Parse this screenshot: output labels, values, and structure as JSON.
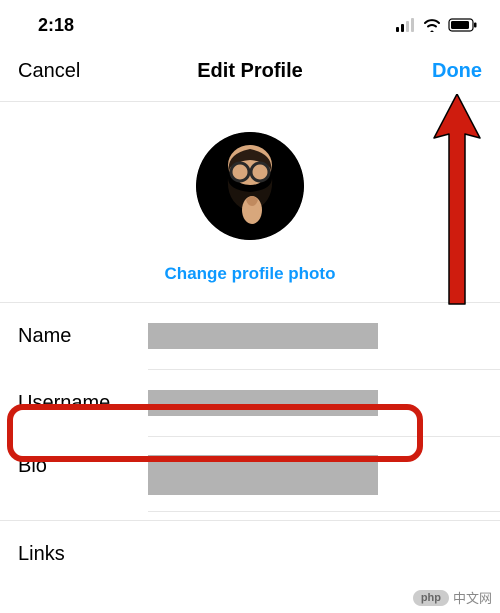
{
  "status": {
    "time": "2:18"
  },
  "nav": {
    "cancel": "Cancel",
    "title": "Edit Profile",
    "done": "Done"
  },
  "photo": {
    "change_label": "Change profile photo"
  },
  "fields": {
    "name": {
      "label": "Name",
      "value": ""
    },
    "username": {
      "label": "Username",
      "value": ""
    },
    "bio": {
      "label": "Bio",
      "value": ""
    },
    "links": {
      "label": "Links",
      "value": ""
    }
  },
  "watermark": {
    "badge": "php",
    "text": "中文网"
  }
}
